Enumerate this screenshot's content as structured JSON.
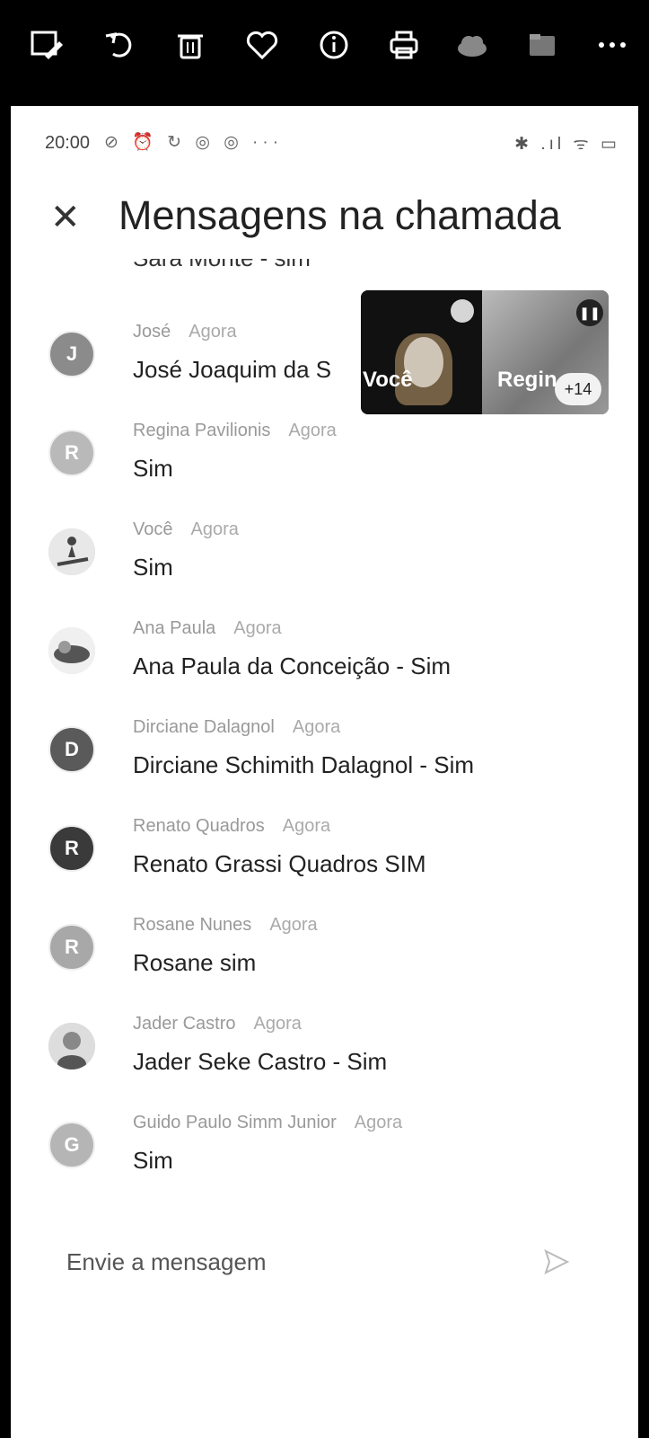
{
  "viewer_toolbar": {
    "icons": [
      "edit-image-icon",
      "rotate-icon",
      "trash-icon",
      "heart-icon",
      "info-icon",
      "print-icon",
      "cloud-icon",
      "folder-icon",
      "more-icon"
    ]
  },
  "status_bar": {
    "time": "20:00",
    "left_icons": "⊘ ⏰ ↻ ◎ ◎ ···",
    "right_icons": "✱ .ıl ᯤ ▭"
  },
  "header": {
    "close_label": "✕",
    "title": "Mensagens na chamada"
  },
  "partial_message": "Sara Monte - sim",
  "messages": [
    {
      "sender": "José",
      "time": "Agora",
      "text": "José Joaquim da S",
      "avatar_letter": "J",
      "avatar_color": "#8b8b8b"
    },
    {
      "sender": "Regina Pavilionis",
      "time": "Agora",
      "text": "Sim",
      "avatar_letter": "R",
      "avatar_color": "#b9b9b9"
    },
    {
      "sender": "Você",
      "time": "Agora",
      "text": "Sim",
      "avatar_letter": "",
      "avatar_color": "#cccccc"
    },
    {
      "sender": "Ana Paula",
      "time": "Agora",
      "text": "Ana Paula da Conceição - Sim",
      "avatar_letter": "",
      "avatar_color": "#aaaaaa"
    },
    {
      "sender": "Dirciane Dalagnol",
      "time": "Agora",
      "text": "Dirciane Schimith Dalagnol - Sim",
      "avatar_letter": "D",
      "avatar_color": "#5a5a5a"
    },
    {
      "sender": "Renato Quadros",
      "time": "Agora",
      "text": "Renato Grassi Quadros SIM",
      "avatar_letter": "R",
      "avatar_color": "#3a3a3a"
    },
    {
      "sender": "Rosane Nunes",
      "time": "Agora",
      "text": "Rosane  sim",
      "avatar_letter": "R",
      "avatar_color": "#a8a8a8"
    },
    {
      "sender": "Jader Castro",
      "time": "Agora",
      "text": "Jader Seke Castro - Sim",
      "avatar_letter": "",
      "avatar_color": "#bbbbbb"
    },
    {
      "sender": "Guido Paulo Simm Junior",
      "time": "Agora",
      "text": "Sim",
      "avatar_letter": "G",
      "avatar_color": "#b5b5b5"
    }
  ],
  "pip": {
    "tile_a_label": "Você",
    "tile_b_label": "Regin",
    "participant_count": "+14"
  },
  "composer": {
    "placeholder": "Envie a mensagem"
  }
}
